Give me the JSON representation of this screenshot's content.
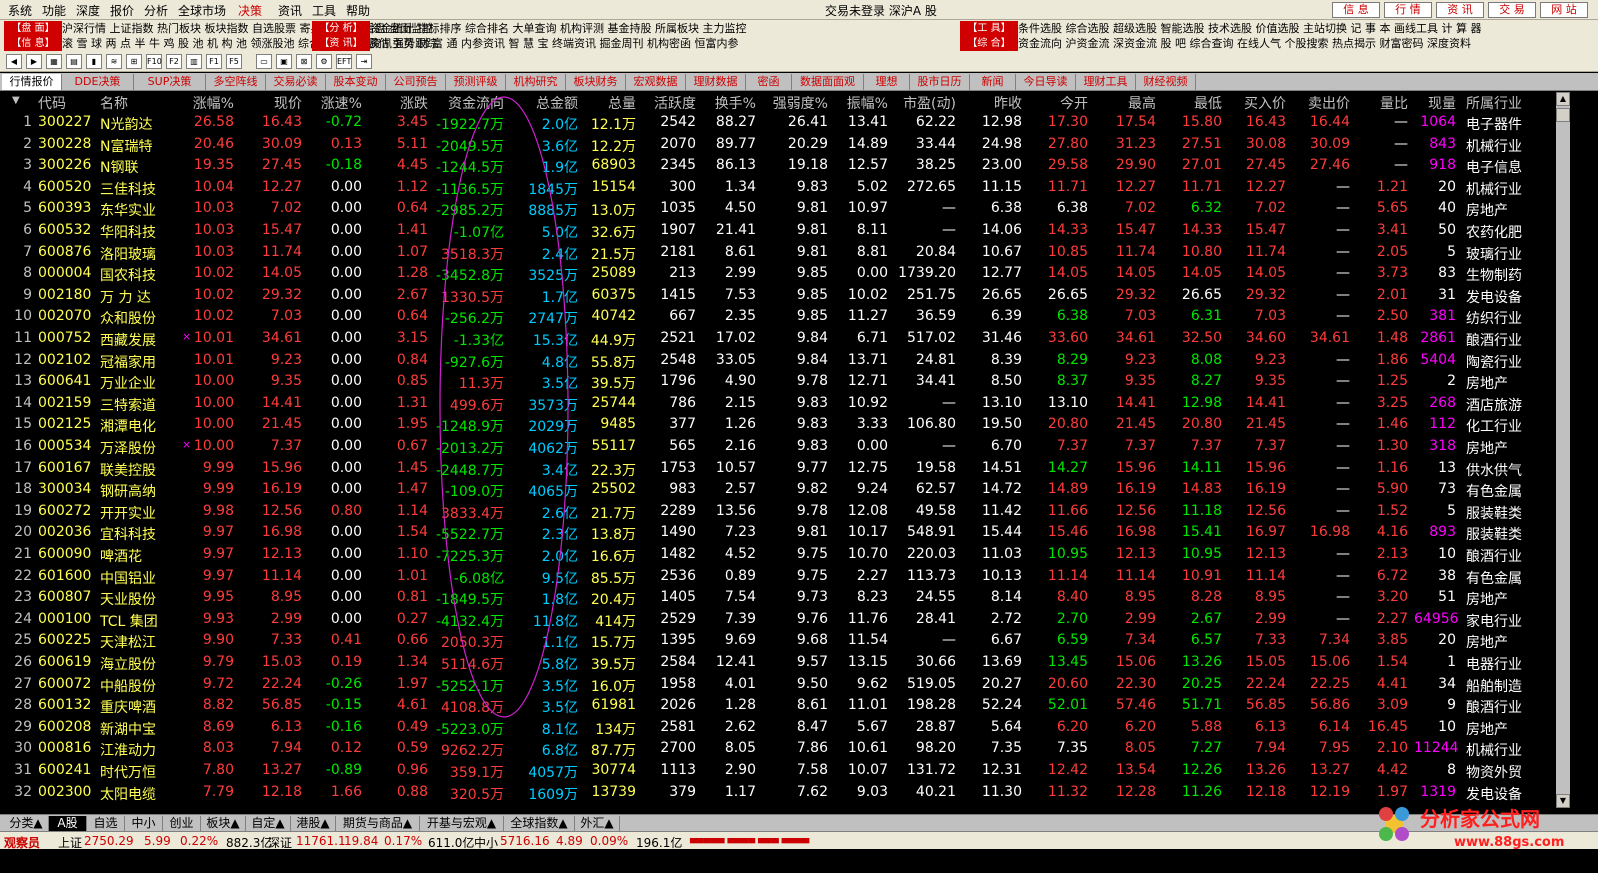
{
  "menu": [
    "系统",
    "功能",
    "深度",
    "报价",
    "分析",
    "全球市场",
    "决策",
    "资讯",
    "工具",
    "帮助"
  ],
  "window_title": "交易未登录  深沪A 股",
  "top_buttons": [
    "信 息",
    "行 情",
    "资 讯",
    "交 易",
    "网 站"
  ],
  "quick_links": [
    {
      "cat": [
        "【盘 面】",
        "【信 息】"
      ],
      "col1": "沪深行情 上证指数 热门板块 板块指数 自选股票 寄兵看盘 L2 看盘 盘面监控",
      "col2": "滚 雪 球 两 点 半 牛 鸡 股 池 机 构 池 领涨股池 综合一号 涨停霸估 强势跟踪"
    },
    {
      "cat": [
        "【分 析】",
        "【资 讯】"
      ],
      "col1": "资金统计 指标排序 综合排名 大单查询 机构评测 基金持股 所属板块 主力监控",
      "col2": "资讯主页 财 富 通 内参资讯 智 慧 宝 终端资讯 掘金周刊 机构密函 恒富内参"
    },
    {
      "cat": [
        "【工 具】",
        "【综 合】"
      ],
      "col1": "条件选股 综合选股 超级选股 智能选股 技术选股 价值选股 主站切换 记 事 本 画线工具 计 算 器",
      "col2": "资金流向 沪资金流 深资金流 股 吧 综合查询 在线人气 个股搜索 热点揭示 财富密码 深度资料"
    }
  ],
  "tabs": [
    "行情报价",
    "DDE决策",
    "SUP决策",
    "多空阵线",
    "交易必读",
    "股本变动",
    "公司预告",
    "预测评级",
    "机构研究",
    "板块财务",
    "宏观数据",
    "理财数据",
    "密函",
    "数据面面观",
    "理想",
    "股市日历",
    "新闻",
    "今日导读",
    "理财工具",
    "财经视频"
  ],
  "headers": [
    "代码",
    "名称",
    "涨幅%",
    "现价",
    "涨速%",
    "涨跌",
    "资金流向",
    "总金额",
    "总量",
    "活跃度",
    "换手%",
    "强弱度%",
    "振幅%",
    "市盈(动)",
    "昨收",
    "今开",
    "最高",
    "最低",
    "买入价",
    "卖出价",
    "量比",
    "现量",
    "所属行业"
  ],
  "rows": [
    [
      "1",
      "300227",
      "N光韵达",
      "",
      "26.58",
      "16.43",
      "-0.72",
      "3.45",
      "-1922.7万",
      "2.0亿",
      "12.1万",
      "2542",
      "88.27",
      "26.41",
      "13.41",
      "62.22",
      "12.98",
      "17.30",
      "17.54",
      "15.80",
      "16.43",
      "16.44",
      "—",
      "1064",
      "电子器件"
    ],
    [
      "2",
      "300228",
      "N富瑞特",
      "",
      "20.46",
      "30.09",
      "0.13",
      "5.11",
      "-2049.5万",
      "3.6亿",
      "12.2万",
      "2070",
      "89.77",
      "20.29",
      "14.89",
      "33.44",
      "24.98",
      "27.80",
      "31.23",
      "27.51",
      "30.08",
      "30.09",
      "—",
      "843",
      "机械行业"
    ],
    [
      "3",
      "300226",
      "N钢联",
      "",
      "19.35",
      "27.45",
      "-0.18",
      "4.45",
      "-1244.5万",
      "1.9亿",
      "68903",
      "2345",
      "86.13",
      "19.18",
      "12.57",
      "38.25",
      "23.00",
      "29.58",
      "29.90",
      "27.01",
      "27.45",
      "27.46",
      "—",
      "918",
      "电子信息"
    ],
    [
      "4",
      "600520",
      "三佳科技",
      "",
      "10.04",
      "12.27",
      "0.00",
      "1.12",
      "-1136.5万",
      "1845万",
      "15154",
      "300",
      "1.34",
      "9.83",
      "5.02",
      "272.65",
      "11.15",
      "11.71",
      "12.27",
      "11.71",
      "12.27",
      "—",
      "1.21",
      "20",
      "机械行业"
    ],
    [
      "5",
      "600393",
      "东华实业",
      "",
      "10.03",
      "7.02",
      "0.00",
      "0.64",
      "-2985.2万",
      "8885万",
      "13.0万",
      "1035",
      "4.50",
      "9.81",
      "10.97",
      "—",
      "6.38",
      "6.38",
      "7.02",
      "6.32",
      "7.02",
      "—",
      "5.65",
      "40",
      "房地产"
    ],
    [
      "6",
      "600532",
      "华阳科技",
      "",
      "10.03",
      "15.47",
      "0.00",
      "1.41",
      "-1.07亿",
      "5.0亿",
      "32.6万",
      "1907",
      "21.41",
      "9.81",
      "8.11",
      "—",
      "14.06",
      "14.33",
      "15.47",
      "14.33",
      "15.47",
      "—",
      "3.41",
      "50",
      "农药化肥"
    ],
    [
      "7",
      "600876",
      "洛阳玻璃",
      "",
      "10.03",
      "11.74",
      "0.00",
      "1.07",
      "3518.3万",
      "2.4亿",
      "21.5万",
      "2181",
      "8.61",
      "9.81",
      "8.81",
      "20.84",
      "10.67",
      "10.85",
      "11.74",
      "10.80",
      "11.74",
      "—",
      "2.05",
      "5",
      "玻璃行业"
    ],
    [
      "8",
      "000004",
      "国农科技",
      "",
      "10.02",
      "14.05",
      "0.00",
      "1.28",
      "-3452.8万",
      "3525万",
      "25089",
      "213",
      "2.99",
      "9.85",
      "0.00",
      "1739.20",
      "12.77",
      "14.05",
      "14.05",
      "14.05",
      "14.05",
      "—",
      "3.73",
      "83",
      "生物制药"
    ],
    [
      "9",
      "002180",
      "万 力 达",
      "",
      "10.02",
      "29.32",
      "0.00",
      "2.67",
      "1330.5万",
      "1.7亿",
      "60375",
      "1415",
      "7.53",
      "9.85",
      "10.02",
      "251.75",
      "26.65",
      "26.65",
      "29.32",
      "26.65",
      "29.32",
      "—",
      "2.01",
      "31",
      "发电设备"
    ],
    [
      "10",
      "002070",
      "众和股份",
      "",
      "10.02",
      "7.03",
      "0.00",
      "0.64",
      "-256.2万",
      "2747万",
      "40742",
      "667",
      "2.35",
      "9.85",
      "11.27",
      "36.59",
      "6.39",
      "6.38",
      "7.03",
      "6.31",
      "7.03",
      "—",
      "2.50",
      "381",
      "纺织行业"
    ],
    [
      "11",
      "000752",
      "西藏发展",
      "×",
      "10.01",
      "34.61",
      "0.00",
      "3.15",
      "-1.33亿",
      "15.3亿",
      "44.9万",
      "2521",
      "17.02",
      "9.84",
      "6.71",
      "517.02",
      "31.46",
      "33.60",
      "34.61",
      "32.50",
      "34.60",
      "34.61",
      "1.48",
      "2861",
      "酿酒行业"
    ],
    [
      "12",
      "002102",
      "冠福家用",
      "",
      "10.01",
      "9.23",
      "0.00",
      "0.84",
      "-927.6万",
      "4.8亿",
      "55.8万",
      "2548",
      "33.05",
      "9.84",
      "13.71",
      "24.81",
      "8.39",
      "8.29",
      "9.23",
      "8.08",
      "9.23",
      "—",
      "1.86",
      "5404",
      "陶瓷行业"
    ],
    [
      "13",
      "600641",
      "万业企业",
      "",
      "10.00",
      "9.35",
      "0.00",
      "0.85",
      "11.3万",
      "3.5亿",
      "39.5万",
      "1796",
      "4.90",
      "9.78",
      "12.71",
      "34.41",
      "8.50",
      "8.37",
      "9.35",
      "8.27",
      "9.35",
      "—",
      "1.25",
      "2",
      "房地产"
    ],
    [
      "14",
      "002159",
      "三特索道",
      "",
      "10.00",
      "14.41",
      "0.00",
      "1.31",
      "499.6万",
      "3573万",
      "25744",
      "786",
      "2.15",
      "9.83",
      "10.92",
      "—",
      "13.10",
      "13.10",
      "14.41",
      "12.98",
      "14.41",
      "—",
      "3.25",
      "268",
      "酒店旅游"
    ],
    [
      "15",
      "002125",
      "湘潭电化",
      "",
      "10.00",
      "21.45",
      "0.00",
      "1.95",
      "-1248.9万",
      "2029万",
      "9485",
      "377",
      "1.26",
      "9.83",
      "3.33",
      "106.80",
      "19.50",
      "20.80",
      "21.45",
      "20.80",
      "21.45",
      "—",
      "1.46",
      "112",
      "化工行业"
    ],
    [
      "16",
      "000534",
      "万泽股份",
      "×",
      "10.00",
      "7.37",
      "0.00",
      "0.67",
      "-2013.2万",
      "4062万",
      "55117",
      "565",
      "2.16",
      "9.83",
      "0.00",
      "—",
      "6.70",
      "7.37",
      "7.37",
      "7.37",
      "7.37",
      "—",
      "1.30",
      "318",
      "房地产"
    ],
    [
      "17",
      "600167",
      "联美控股",
      "",
      "9.99",
      "15.96",
      "0.00",
      "1.45",
      "-2448.7万",
      "3.4亿",
      "22.3万",
      "1753",
      "10.57",
      "9.77",
      "12.75",
      "19.58",
      "14.51",
      "14.27",
      "15.96",
      "14.11",
      "15.96",
      "—",
      "1.16",
      "13",
      "供水供气"
    ],
    [
      "18",
      "300034",
      "钢研高纳",
      "",
      "9.99",
      "16.19",
      "0.00",
      "1.47",
      "-109.0万",
      "4065万",
      "25502",
      "983",
      "2.57",
      "9.82",
      "9.24",
      "62.57",
      "14.72",
      "14.89",
      "16.19",
      "14.83",
      "16.19",
      "—",
      "5.90",
      "73",
      "有色金属"
    ],
    [
      "19",
      "600272",
      "开开实业",
      "",
      "9.98",
      "12.56",
      "0.80",
      "1.14",
      "3833.4万",
      "2.6亿",
      "21.7万",
      "2289",
      "13.56",
      "9.78",
      "12.08",
      "49.58",
      "11.42",
      "11.66",
      "12.56",
      "11.18",
      "12.56",
      "—",
      "1.52",
      "5",
      "服装鞋类"
    ],
    [
      "20",
      "002036",
      "宜科科技",
      "",
      "9.97",
      "16.98",
      "0.00",
      "1.54",
      "-5522.7万",
      "2.3亿",
      "13.8万",
      "1490",
      "7.23",
      "9.81",
      "10.17",
      "548.91",
      "15.44",
      "15.46",
      "16.98",
      "15.41",
      "16.97",
      "16.98",
      "4.16",
      "893",
      "服装鞋类"
    ],
    [
      "21",
      "600090",
      "啤酒花",
      "",
      "9.97",
      "12.13",
      "0.00",
      "1.10",
      "-7225.3万",
      "2.0亿",
      "16.6万",
      "1482",
      "4.52",
      "9.75",
      "10.70",
      "220.03",
      "11.03",
      "10.95",
      "12.13",
      "10.95",
      "12.13",
      "—",
      "2.13",
      "10",
      "酿酒行业"
    ],
    [
      "22",
      "601600",
      "中国铝业",
      "",
      "9.97",
      "11.14",
      "0.00",
      "1.01",
      "-6.08亿",
      "9.5亿",
      "85.5万",
      "2536",
      "0.89",
      "9.75",
      "2.27",
      "113.73",
      "10.13",
      "11.14",
      "11.14",
      "10.91",
      "11.14",
      "—",
      "6.72",
      "38",
      "有色金属"
    ],
    [
      "23",
      "600807",
      "天业股份",
      "",
      "9.95",
      "8.95",
      "0.00",
      "0.81",
      "-1849.5万",
      "1.8亿",
      "20.4万",
      "1405",
      "7.54",
      "9.73",
      "8.23",
      "24.55",
      "8.14",
      "8.40",
      "8.95",
      "8.28",
      "8.95",
      "—",
      "3.20",
      "51",
      "房地产"
    ],
    [
      "24",
      "000100",
      "TCL 集团",
      "",
      "9.93",
      "2.99",
      "0.00",
      "0.27",
      "-4132.4万",
      "11.8亿",
      "414万",
      "2529",
      "7.39",
      "9.76",
      "11.76",
      "28.41",
      "2.72",
      "2.70",
      "2.99",
      "2.67",
      "2.99",
      "—",
      "2.27",
      "64956",
      "家电行业"
    ],
    [
      "25",
      "600225",
      "天津松江",
      "",
      "9.90",
      "7.33",
      "0.41",
      "0.66",
      "2050.3万",
      "1.1亿",
      "15.7万",
      "1395",
      "9.69",
      "9.68",
      "11.54",
      "—",
      "6.67",
      "6.59",
      "7.34",
      "6.57",
      "7.33",
      "7.34",
      "3.85",
      "20",
      "房地产"
    ],
    [
      "26",
      "600619",
      "海立股份",
      "",
      "9.79",
      "15.03",
      "0.19",
      "1.34",
      "5114.6万",
      "5.8亿",
      "39.5万",
      "2584",
      "12.41",
      "9.57",
      "13.15",
      "30.66",
      "13.69",
      "13.45",
      "15.06",
      "13.26",
      "15.05",
      "15.06",
      "1.54",
      "1",
      "电器行业"
    ],
    [
      "27",
      "600072",
      "中船股份",
      "",
      "9.72",
      "22.24",
      "-0.26",
      "1.97",
      "-5252.1万",
      "3.5亿",
      "16.0万",
      "1958",
      "4.01",
      "9.50",
      "9.62",
      "519.05",
      "20.27",
      "20.60",
      "22.30",
      "20.25",
      "22.24",
      "22.25",
      "4.41",
      "34",
      "船舶制造"
    ],
    [
      "28",
      "600132",
      "重庆啤酒",
      "",
      "8.82",
      "56.85",
      "-0.15",
      "4.61",
      "4108.8万",
      "3.5亿",
      "61981",
      "2026",
      "1.28",
      "8.61",
      "11.01",
      "198.28",
      "52.24",
      "52.01",
      "57.46",
      "51.71",
      "56.85",
      "56.86",
      "3.09",
      "9",
      "酿酒行业"
    ],
    [
      "29",
      "600208",
      "新湖中宝",
      "",
      "8.69",
      "6.13",
      "-0.16",
      "0.49",
      "-5223.0万",
      "8.1亿",
      "134万",
      "2581",
      "2.62",
      "8.47",
      "5.67",
      "28.87",
      "5.64",
      "6.20",
      "6.20",
      "5.88",
      "6.13",
      "6.14",
      "16.45",
      "10",
      "房地产"
    ],
    [
      "30",
      "000816",
      "江淮动力",
      "",
      "8.03",
      "7.94",
      "0.12",
      "0.59",
      "9262.2万",
      "6.8亿",
      "87.7万",
      "2700",
      "8.05",
      "7.86",
      "10.61",
      "98.20",
      "7.35",
      "7.35",
      "8.05",
      "7.27",
      "7.94",
      "7.95",
      "2.10",
      "11244",
      "机械行业"
    ],
    [
      "31",
      "600241",
      "时代万恒",
      "",
      "7.80",
      "13.27",
      "-0.89",
      "0.96",
      "359.1万",
      "4057万",
      "30774",
      "1113",
      "2.90",
      "7.58",
      "10.07",
      "131.72",
      "12.31",
      "12.42",
      "13.54",
      "12.26",
      "13.26",
      "13.27",
      "4.42",
      "8",
      "物资外贸"
    ],
    [
      "32",
      "002300",
      "太阳电缆",
      "",
      "7.79",
      "12.18",
      "1.66",
      "0.88",
      "320.5万",
      "1609万",
      "13739",
      "379",
      "1.17",
      "7.62",
      "9.03",
      "40.21",
      "11.30",
      "11.32",
      "12.28",
      "11.26",
      "12.18",
      "12.19",
      "1.97",
      "1319",
      "发电设备"
    ]
  ],
  "bottom_tabs": [
    "分类▲",
    "A股",
    "自选",
    "中小",
    "创业",
    "板块▲",
    "自定▲",
    "港股▲",
    "期货与商品▲",
    "开基与宏观▲",
    "全球指数▲",
    "外汇▲"
  ],
  "status": {
    "user": "观察员",
    "sh_label": "上证",
    "sh_val": "2750.29",
    "sh_chg": "5.99",
    "sh_pct": "0.22%",
    "sh_amt": "882.3亿",
    "sz_label": "深证",
    "sz_val": "11761.1",
    "sz_chg": "19.84",
    "sz_pct": "0.17%",
    "sz_amt": "611.0亿",
    "zx_label": "中小",
    "zx_val": "5716.16",
    "zx_chg": "4.89",
    "zx_pct": "0.09%",
    "zx_amt": "196.1亿"
  },
  "logo_text": "分析家公式网",
  "logo_url": "www.88gs.com"
}
